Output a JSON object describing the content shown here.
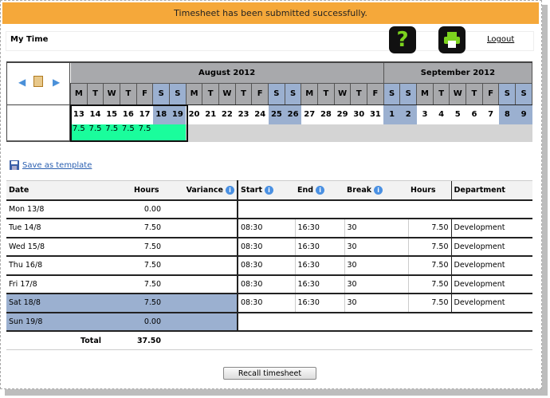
{
  "banner": {
    "message": "Timesheet has been submitted successfully."
  },
  "header": {
    "title": "My Time",
    "help_icon": "help-question-icon",
    "print_icon": "printer-icon",
    "logout": "Logout"
  },
  "calendar": {
    "months": [
      {
        "label": "August 2012",
        "days": 19
      },
      {
        "label": "September 2012",
        "days": 9
      }
    ],
    "day_letters": [
      "M",
      "T",
      "W",
      "T",
      "F",
      "S",
      "S",
      "M",
      "T",
      "W",
      "T",
      "F",
      "S",
      "S",
      "M",
      "T",
      "W",
      "T",
      "F",
      "S",
      "S",
      "M",
      "T",
      "W",
      "T",
      "F",
      "S",
      "S"
    ],
    "dates": [
      "13",
      "14",
      "15",
      "16",
      "17",
      "18",
      "19",
      "20",
      "21",
      "22",
      "23",
      "24",
      "25",
      "26",
      "27",
      "28",
      "29",
      "30",
      "31",
      "1",
      "2",
      "3",
      "4",
      "5",
      "6",
      "7",
      "8",
      "9"
    ],
    "weekend": [
      false,
      false,
      false,
      false,
      false,
      true,
      true,
      false,
      false,
      false,
      false,
      false,
      true,
      true,
      false,
      false,
      false,
      false,
      false,
      true,
      true,
      false,
      false,
      false,
      false,
      false,
      true,
      true
    ],
    "hours": [
      "7.5",
      "7.5",
      "7.5",
      "7.5",
      "7.5",
      "",
      "",
      "",
      "",
      "",
      "",
      "",
      "",
      "",
      "",
      "",
      "",
      "",
      "",
      "",
      "",
      "",
      "",
      "",
      "",
      "",
      "",
      ""
    ],
    "selected_week": "13-19 August 2012",
    "colors": {
      "selected": "#1AFD9C",
      "weekend": "#9BB0D0",
      "header": "#A8A9AC"
    }
  },
  "save_template": "Save as template",
  "table": {
    "headers": {
      "date": "Date",
      "hours": "Hours",
      "variance": "Variance",
      "start": "Start",
      "end": "End",
      "break": "Break",
      "hours2": "Hours",
      "department": "Department"
    },
    "rows": [
      {
        "date": "Mon 13/8",
        "hours": "0.00",
        "weekend": false
      },
      {
        "date": "Tue 14/8",
        "hours": "7.50",
        "start": "08:30",
        "end": "16:30",
        "break": "30",
        "hours2": "7.50",
        "department": "Development",
        "weekend": false
      },
      {
        "date": "Wed 15/8",
        "hours": "7.50",
        "start": "08:30",
        "end": "16:30",
        "break": "30",
        "hours2": "7.50",
        "department": "Development",
        "weekend": false
      },
      {
        "date": "Thu 16/8",
        "hours": "7.50",
        "start": "08:30",
        "end": "16:30",
        "break": "30",
        "hours2": "7.50",
        "department": "Development",
        "weekend": false
      },
      {
        "date": "Fri 17/8",
        "hours": "7.50",
        "start": "08:30",
        "end": "16:30",
        "break": "30",
        "hours2": "7.50",
        "department": "Development",
        "weekend": false
      },
      {
        "date": "Sat 18/8",
        "hours": "7.50",
        "start": "08:30",
        "end": "16:30",
        "break": "30",
        "hours2": "7.50",
        "department": "Development",
        "weekend": true
      },
      {
        "date": "Sun 19/8",
        "hours": "0.00",
        "weekend": true
      }
    ],
    "total_label": "Total",
    "total_value": "37.50"
  },
  "recall_button": "Recall timesheet"
}
